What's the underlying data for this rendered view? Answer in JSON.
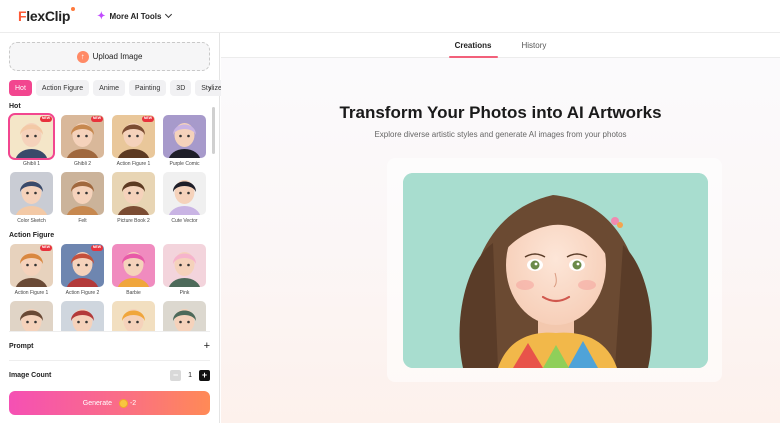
{
  "header": {
    "logo_f": "F",
    "logo_rest": "lexClip",
    "more_tools_label": "More AI Tools"
  },
  "sidebar": {
    "upload_label": "Upload Image",
    "style_tabs": [
      "Hot",
      "Action Figure",
      "Anime",
      "Painting",
      "3D",
      "Stylize"
    ],
    "active_tab": "Hot",
    "sections": [
      {
        "title": "Hot",
        "items": [
          {
            "label": "Ghibli 1",
            "badge": "NEW",
            "selected": true
          },
          {
            "label": "Ghibli 2",
            "badge": "NEW"
          },
          {
            "label": "Action Figure 1",
            "badge": "NEW"
          },
          {
            "label": "Purple Comic",
            "badge": ""
          },
          {
            "label": "Color Sketch",
            "badge": ""
          },
          {
            "label": "Felt",
            "badge": ""
          },
          {
            "label": "Picture Book 2",
            "badge": ""
          },
          {
            "label": "Cute Vector",
            "badge": ""
          }
        ]
      },
      {
        "title": "Action Figure",
        "items": [
          {
            "label": "Action Figure 1",
            "badge": "NEW"
          },
          {
            "label": "Action Figure 2",
            "badge": "NEW"
          },
          {
            "label": "Barbie",
            "badge": ""
          },
          {
            "label": "Pink",
            "badge": ""
          },
          {
            "label": "",
            "badge": ""
          },
          {
            "label": "",
            "badge": ""
          },
          {
            "label": "",
            "badge": ""
          },
          {
            "label": "",
            "badge": ""
          }
        ]
      }
    ],
    "prompt_label": "Prompt",
    "image_count_label": "Image Count",
    "image_count_value": "1",
    "generate_label": "Generate",
    "generate_cost": "-2"
  },
  "main": {
    "tabs": [
      "Creations",
      "History"
    ],
    "active_tab": "Creations",
    "title": "Transform Your Photos into AI Artworks",
    "subtitle": "Explore diverse artistic styles and generate AI images from your photos"
  },
  "colors": {
    "accent": "#f2468f",
    "badge": "#e8323c",
    "photo_bg": "#a8ddcf"
  }
}
